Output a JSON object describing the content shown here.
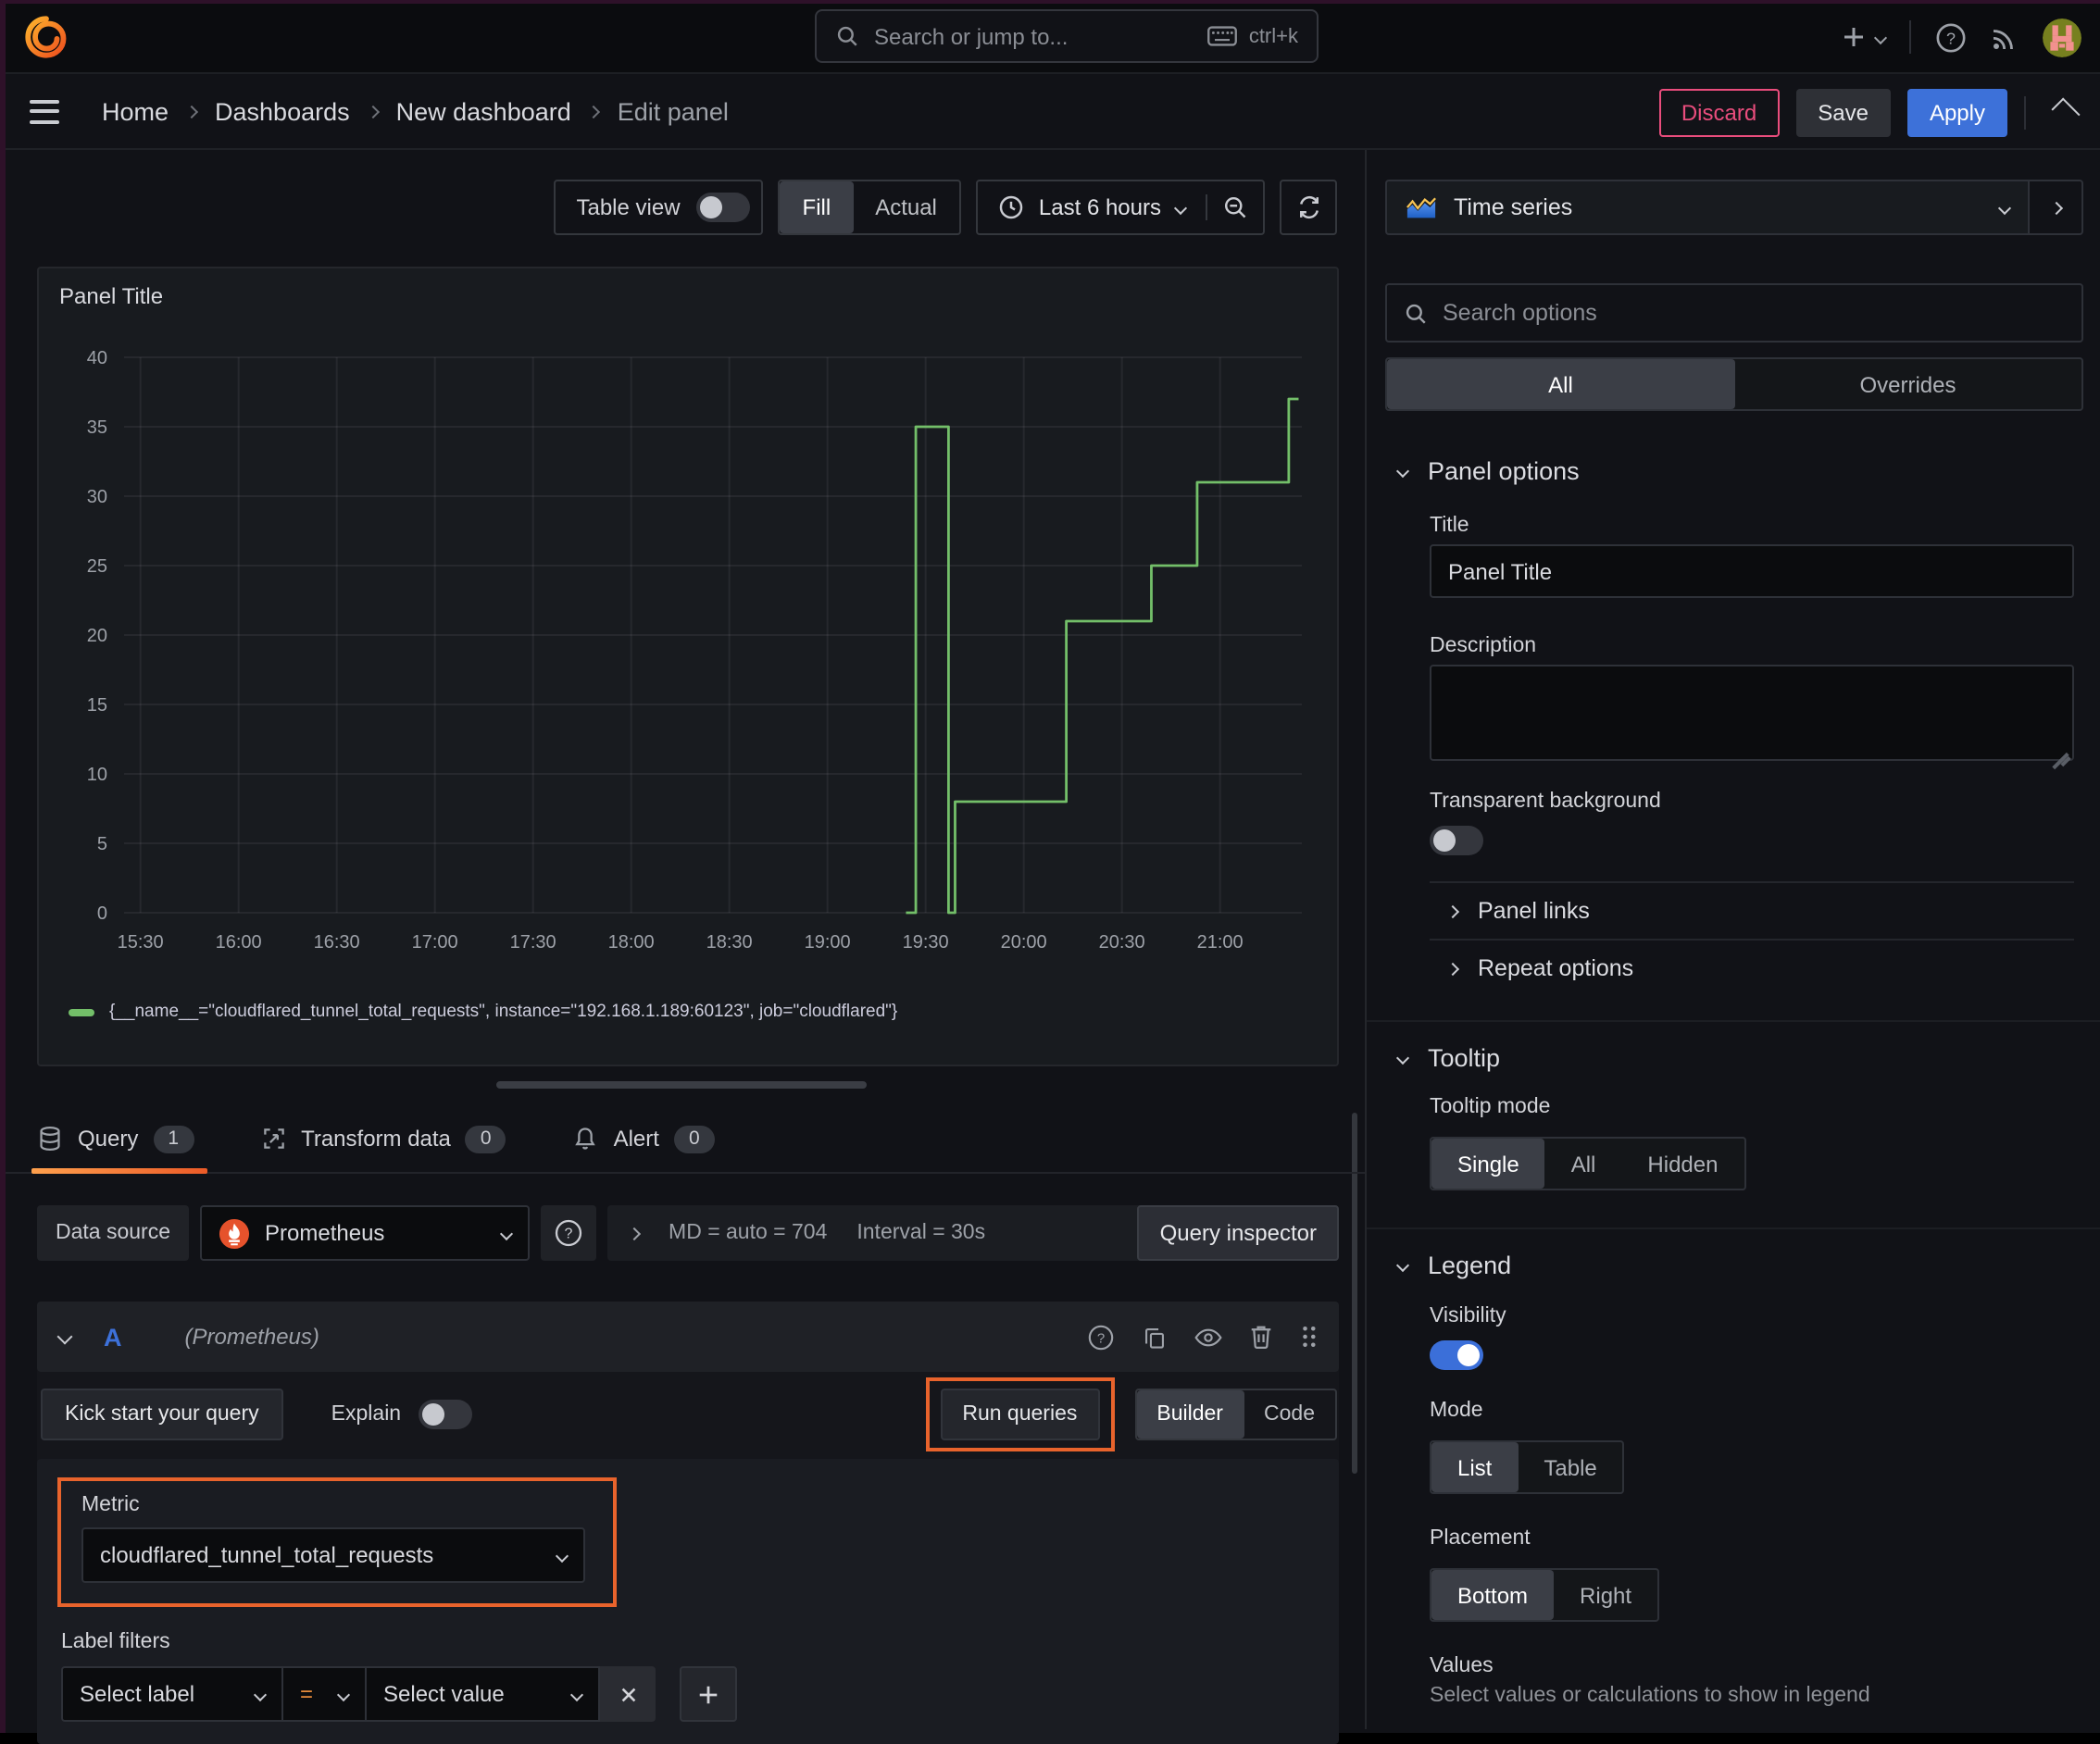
{
  "colors": {
    "accent_blue": "#3d71d9",
    "series_green": "#73bf69",
    "annotation_orange": "#e8632c",
    "discard_pink": "#ea4d7d",
    "tab_underline_orange": "#ff780a"
  },
  "topbar": {
    "search_placeholder": "Search or jump to...",
    "shortcut": "ctrl+k"
  },
  "breadcrumb": {
    "items": [
      "Home",
      "Dashboards",
      "New dashboard",
      "Edit panel"
    ]
  },
  "nav_actions": {
    "discard": "Discard",
    "save": "Save",
    "apply": "Apply"
  },
  "toolbar": {
    "table_view": "Table view",
    "fill": "Fill",
    "actual": "Actual",
    "time_range": "Last 6 hours"
  },
  "chart_data": {
    "type": "line",
    "render": "stepped",
    "title": "Panel Title",
    "x_ticks": [
      "15:30",
      "16:00",
      "16:30",
      "17:00",
      "17:30",
      "18:00",
      "18:30",
      "19:00",
      "19:30",
      "20:00",
      "20:30",
      "21:00"
    ],
    "y_ticks": [
      0,
      5,
      10,
      15,
      20,
      25,
      30,
      35,
      40
    ],
    "ylim": [
      0,
      40
    ],
    "xlim": [
      "15:25",
      "21:25"
    ],
    "grid": true,
    "legend_position": "bottom",
    "series": [
      {
        "name": "{__name__=\"cloudflared_tunnel_total_requests\", instance=\"192.168.1.189:60123\", job=\"cloudflared\"}",
        "color": "#73bf69",
        "segments": [
          {
            "from": "19:24",
            "to": "19:27",
            "value": 0
          },
          {
            "from": "19:27",
            "to": "19:37",
            "value": 35
          },
          {
            "from": "19:37",
            "to": "19:39",
            "value": 0
          },
          {
            "from": "19:39",
            "to": "20:13",
            "value": 8
          },
          {
            "from": "20:13",
            "to": "20:39",
            "value": 21
          },
          {
            "from": "20:39",
            "to": "20:53",
            "value": 25
          },
          {
            "from": "20:53",
            "to": "21:21",
            "value": 31
          },
          {
            "from": "21:21",
            "to": "21:24",
            "value": 37
          }
        ]
      }
    ]
  },
  "query_section": {
    "tabs": [
      {
        "label": "Query",
        "count": "1"
      },
      {
        "label": "Transform data",
        "count": "0"
      },
      {
        "label": "Alert",
        "count": "0"
      }
    ],
    "datasource_label": "Data source",
    "datasource_value": "Prometheus",
    "stats_md": "MD = auto = 704",
    "stats_interval": "Interval = 30s",
    "inspector": "Query inspector",
    "row_ref": "A",
    "row_hint": "(Prometheus)",
    "kickstart": "Kick start your query",
    "explain": "Explain",
    "run": "Run queries",
    "builder": "Builder",
    "code": "Code",
    "metric_label": "Metric",
    "metric_value": "cloudflared_tunnel_total_requests",
    "filters_label": "Label filters",
    "select_label": "Select label",
    "operator": "=",
    "select_value": "Select value"
  },
  "options": {
    "viz_type": "Time series",
    "search_placeholder": "Search options",
    "tab_all": "All",
    "tab_overrides": "Overrides",
    "panel_options": "Panel options",
    "title_label": "Title",
    "title_value": "Panel Title",
    "description_label": "Description",
    "transparent_label": "Transparent background",
    "panel_links": "Panel links",
    "repeat_options": "Repeat options",
    "tooltip_header": "Tooltip",
    "tooltip_mode_label": "Tooltip mode",
    "tooltip_modes": [
      "Single",
      "All",
      "Hidden"
    ],
    "legend_header": "Legend",
    "visibility_label": "Visibility",
    "mode_label": "Mode",
    "legend_modes": [
      "List",
      "Table"
    ],
    "placement_label": "Placement",
    "placements": [
      "Bottom",
      "Right"
    ],
    "values_label": "Values",
    "values_hint": "Select values or calculations to show in legend"
  }
}
